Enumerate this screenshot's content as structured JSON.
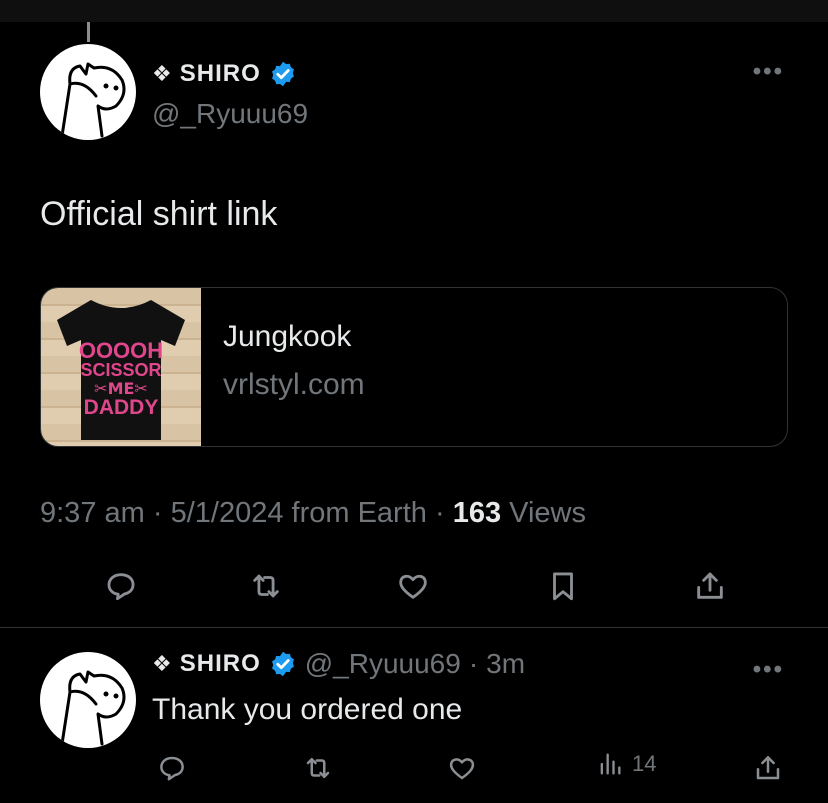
{
  "main_tweet": {
    "author": {
      "prefix": "❖",
      "display_name": "SHIRO",
      "handle": "@_Ryuuu69",
      "verified": true
    },
    "text": "Official shirt link",
    "link_card": {
      "title": "Jungkook",
      "domain": "vrlstyl.com",
      "shirt_text": [
        "OOOOH",
        "SCISSOR",
        "✂ME✂",
        "DADDY"
      ]
    },
    "meta": {
      "time": "9:37 am",
      "date": "5/1/2024",
      "source": "from Earth",
      "views_count": "163",
      "views_label": "Views"
    },
    "actions": [
      "reply-icon",
      "retweet-icon",
      "like-icon",
      "bookmark-icon",
      "share-icon"
    ]
  },
  "reply": {
    "author": {
      "prefix": "❖",
      "display_name": "SHIRO",
      "handle": "@_Ryuuu69",
      "time": "3m",
      "verified": true
    },
    "text": "Thank you ordered one",
    "views": "14"
  },
  "colors": {
    "background": "#000000",
    "text": "#e7e9ea",
    "muted": "#71767b",
    "verified_blue": "#1d9bf0",
    "shirt_print": "#e0468c"
  }
}
